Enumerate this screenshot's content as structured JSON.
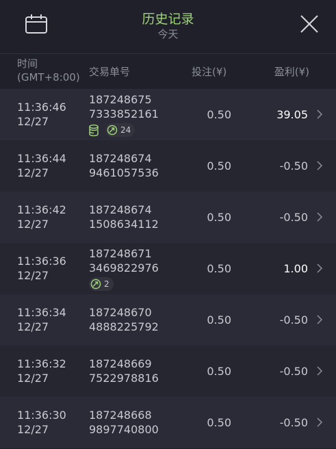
{
  "header": {
    "title": "历史记录",
    "subtitle": "今天",
    "calendar_icon": "calendar-icon",
    "close_icon": "close-icon"
  },
  "columns": {
    "time_line1": "时间",
    "time_line2": "(GMT+8:00)",
    "trade_id": "交易单号",
    "bet": "投注(¥)",
    "profit": "盈利(¥)"
  },
  "colors": {
    "title": "#9fd27a",
    "badge_icon": "#9fd27a",
    "background": "#1f2029"
  },
  "rows": [
    {
      "time": "11:36:46",
      "date": "12/27",
      "id1": "187248675",
      "id2": "7333852161",
      "bet": "0.50",
      "profit": "39.05",
      "win": true,
      "coins": true,
      "pill": "24"
    },
    {
      "time": "11:36:44",
      "date": "12/27",
      "id1": "187248674",
      "id2": "9461057536",
      "bet": "0.50",
      "profit": "-0.50",
      "win": false,
      "coins": false,
      "pill": null
    },
    {
      "time": "11:36:42",
      "date": "12/27",
      "id1": "187248674",
      "id2": "1508634112",
      "bet": "0.50",
      "profit": "-0.50",
      "win": false,
      "coins": false,
      "pill": null
    },
    {
      "time": "11:36:36",
      "date": "12/27",
      "id1": "187248671",
      "id2": "3469822976",
      "bet": "0.50",
      "profit": "1.00",
      "win": true,
      "coins": false,
      "pill": "2"
    },
    {
      "time": "11:36:34",
      "date": "12/27",
      "id1": "187248670",
      "id2": "4888225792",
      "bet": "0.50",
      "profit": "-0.50",
      "win": false,
      "coins": false,
      "pill": null
    },
    {
      "time": "11:36:32",
      "date": "12/27",
      "id1": "187248669",
      "id2": "7522978816",
      "bet": "0.50",
      "profit": "-0.50",
      "win": false,
      "coins": false,
      "pill": null
    },
    {
      "time": "11:36:30",
      "date": "12/27",
      "id1": "187248668",
      "id2": "9897740800",
      "bet": "0.50",
      "profit": "-0.50",
      "win": false,
      "coins": false,
      "pill": null
    }
  ]
}
